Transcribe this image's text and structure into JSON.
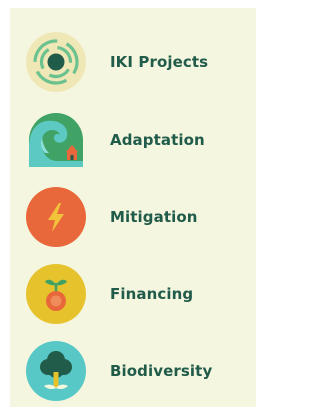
{
  "colors": {
    "panel_background": "#f4f6e0",
    "label_text": "#215b4a",
    "iki_ring": "#f0e7b6",
    "iki_stroke": "#6cc28f",
    "adaptation_green": "#40a365",
    "adaptation_wave": "#5ccac2",
    "mitigation_orange": "#e8683b",
    "financing_yellow": "#e6c22d",
    "biodiversity_teal": "#58c8c6"
  },
  "nav": {
    "items": [
      {
        "label": "IKI Projects",
        "icon": "iki-projects-icon"
      },
      {
        "label": "Adaptation",
        "icon": "wave-house-icon"
      },
      {
        "label": "Mitigation",
        "icon": "lightning-bolt-icon"
      },
      {
        "label": "Financing",
        "icon": "coin-sprout-icon"
      },
      {
        "label": "Biodiversity",
        "icon": "tree-icon"
      }
    ]
  }
}
